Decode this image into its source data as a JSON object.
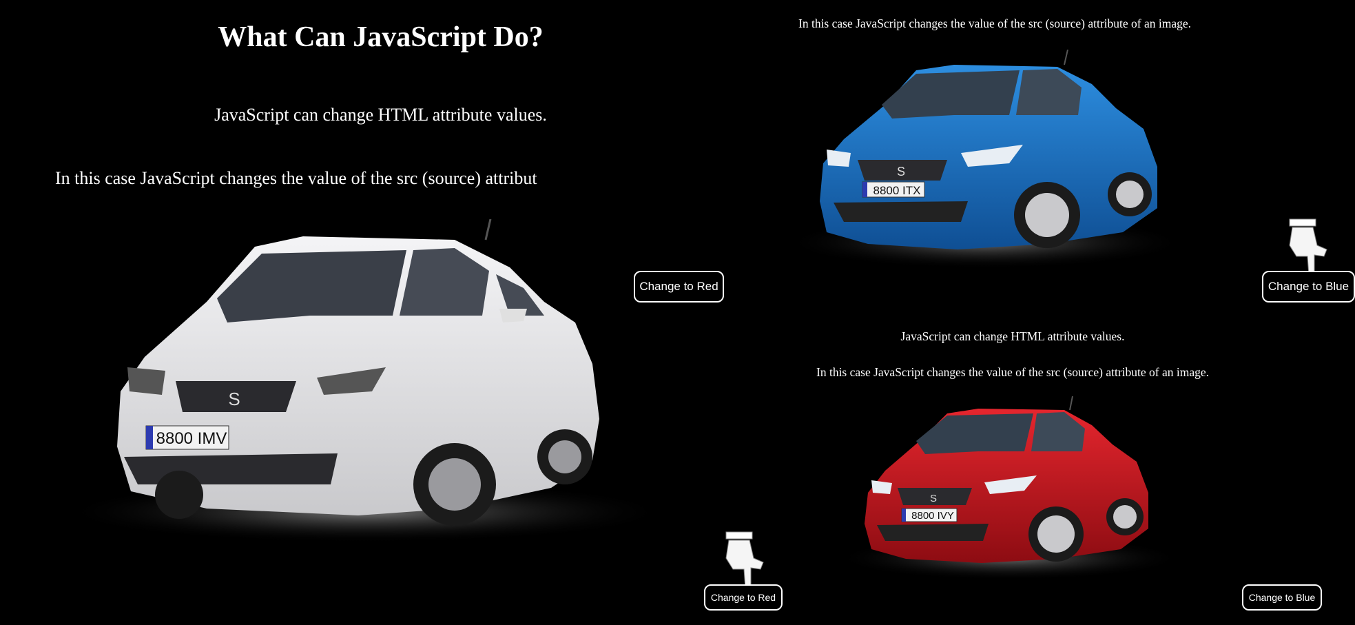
{
  "left": {
    "heading": "What Can JavaScript Do?",
    "para1": "JavaScript can change HTML attribute values.",
    "para2": "In this case JavaScript changes the value of the src (source) attribut",
    "car": {
      "color_name": "white",
      "body_color": "#e6e6e8",
      "plate": "8800 IMV"
    },
    "btn_red": "Change to Red",
    "btn_red2": "Change to Red"
  },
  "top_right": {
    "para": "In this case JavaScript changes the value of the src (source) attribute of an image.",
    "car": {
      "color_name": "blue",
      "body_color": "#1b72c4",
      "plate": "8800 ITX"
    },
    "btn_blue": "Change to Blue"
  },
  "bottom_right": {
    "para1": "JavaScript can change HTML attribute values.",
    "para2": "In this case JavaScript changes the value of the src (source) attribute of an image.",
    "car": {
      "color_name": "red",
      "body_color": "#c8141c",
      "plate": "8800 IVY"
    },
    "btn_blue": "Change to Blue"
  },
  "icons": {
    "cursor": "hand-pointer-icon"
  }
}
